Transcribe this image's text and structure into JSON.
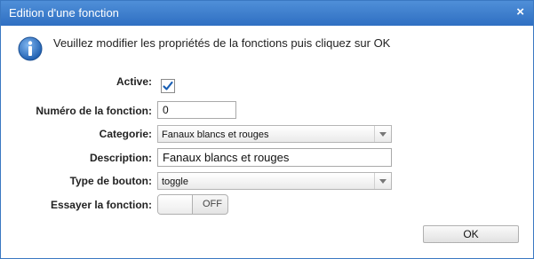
{
  "dialog": {
    "title": "Edition d'une fonction",
    "close_symbol": "×",
    "info_icon": "info-icon",
    "info_message": "Veuillez modifier les propriétés de la fonctions puis cliquez sur OK"
  },
  "form": {
    "active": {
      "label": "Active:",
      "checked": true
    },
    "numero": {
      "label": "Numéro de la fonction:",
      "value": "0"
    },
    "categorie": {
      "label": "Categorie:",
      "value": "Fanaux blancs et rouges"
    },
    "description": {
      "label": "Description:",
      "value": "Fanaux blancs et rouges"
    },
    "type_bouton": {
      "label": "Type de bouton:",
      "value": "toggle"
    },
    "essayer": {
      "label": "Essayer la fonction:",
      "state": "OFF"
    }
  },
  "buttons": {
    "ok_label": "OK"
  },
  "colors": {
    "titlebar": "#2f6fc2",
    "accent": "#1a5fb4"
  }
}
